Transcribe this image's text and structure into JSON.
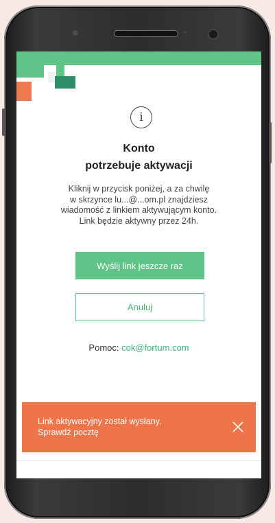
{
  "modal": {
    "title_line1": "Konto",
    "title_line2": "potrzebuje aktywacji",
    "description_lines": [
      "Kliknij w przycisk poniżej, a za chwilę",
      "w skrzynce lu...@...om.pl znajdziesz",
      "wiadomość z linkiem aktywującym konto.",
      "Link będzie aktywny przez 24h."
    ],
    "resend_button": "Wyślij link jeszcze raz",
    "cancel_button": "Anuluj",
    "help_label": "Pomoc:",
    "help_email": "cok@fortum.com"
  },
  "toast": {
    "line1": "Link aktywacyjny został wysłany.",
    "line2": "Sprawdź pocztę"
  },
  "colors": {
    "brand_green": "#5fc487",
    "dark_green": "#2f8f6a",
    "toast_orange": "#ee754a"
  },
  "icons": {
    "info": "info-icon",
    "close": "close-icon"
  }
}
